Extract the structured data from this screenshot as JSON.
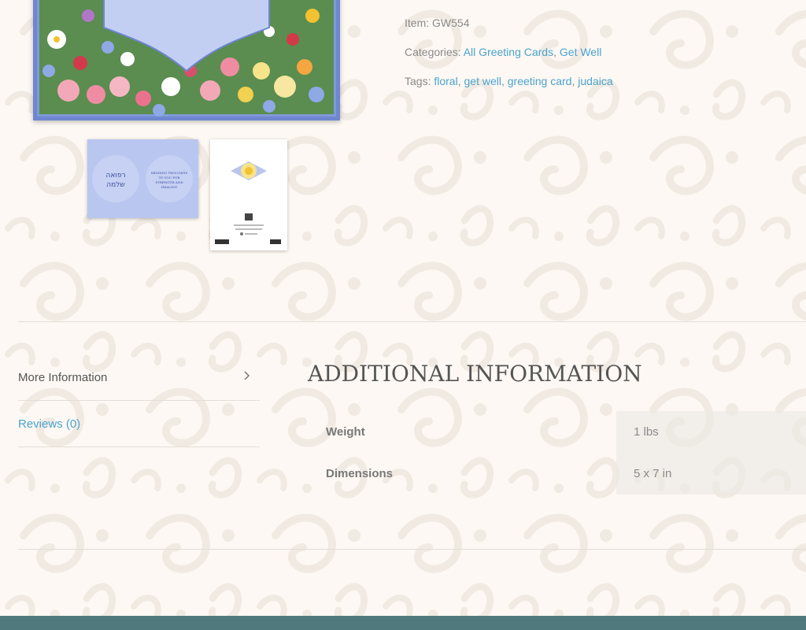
{
  "product_meta": {
    "item_label": "Item:",
    "item_value": "GW554",
    "categories_label": "Categories:",
    "categories": [
      "All Greeting Cards",
      "Get Well"
    ],
    "tags_label": "Tags:",
    "tags": [
      "floral",
      "get well",
      "greeting card",
      "judaica"
    ]
  },
  "thumbnails": {
    "thumb1": {
      "hebrew_text": "רפואה שלמה",
      "english_text": "SENDING THOUGHTS TO YOU FOR STRENGTH AND HEALING"
    }
  },
  "tabs": [
    {
      "label": "More Information"
    },
    {
      "label": "Reviews (0)"
    }
  ],
  "additional_info": {
    "title": "ADDITIONAL INFORMATION",
    "rows": [
      {
        "label": "Weight",
        "value": "1 lbs"
      },
      {
        "label": "Dimensions",
        "value": "5 x 7 in"
      }
    ]
  },
  "colors": {
    "link": "#4aa3cf",
    "footer": "#4f797d",
    "card_border": "#6f86d0"
  },
  "icons": {
    "tab_arrow": "chevron-right-icon"
  }
}
